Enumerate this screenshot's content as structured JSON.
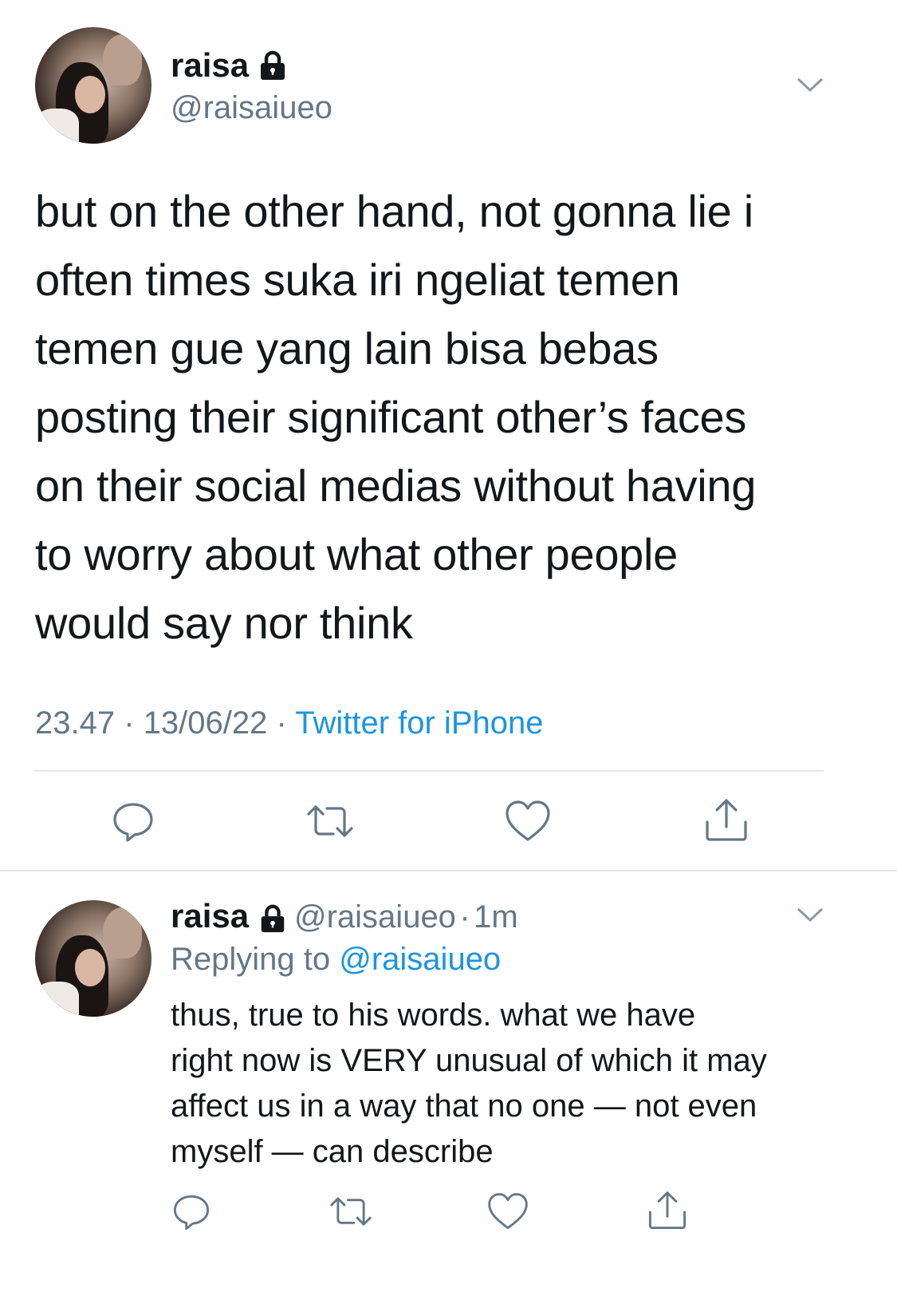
{
  "main_tweet": {
    "author_name": "raisa",
    "author_handle": "@raisaiueo",
    "text_lines": [
      "but on the other hand, not gonna lie i",
      "often times suka iri ngeliat temen",
      "temen gue yang lain bisa bebas",
      "posting their significant other’s faces",
      "on their social medias without having",
      "to worry about what other people",
      "would say nor think"
    ],
    "time": "23.47",
    "separator": "·",
    "date": "13/06/22",
    "source": "Twitter for iPhone"
  },
  "reply_tweet": {
    "author_name": "raisa",
    "author_handle": "@raisaiueo",
    "separator": "·",
    "age": "1m",
    "replying_label": "Replying to",
    "replying_to": "@raisaiueo",
    "text_lines": [
      "thus, true to his words. what we have",
      "right now is VERY unusual of which it may",
      "affect us in a way that no one — not even",
      "myself — can describe"
    ]
  },
  "icons": {
    "protected": "lock-icon",
    "menu": "chevron-down-icon",
    "reply": "reply-icon",
    "retweet": "retweet-icon",
    "like": "heart-icon",
    "share": "share-icon"
  },
  "colors": {
    "text": "#14171a",
    "secondary": "#657786",
    "link": "#1b95e0",
    "divider": "#e1e8ed"
  }
}
